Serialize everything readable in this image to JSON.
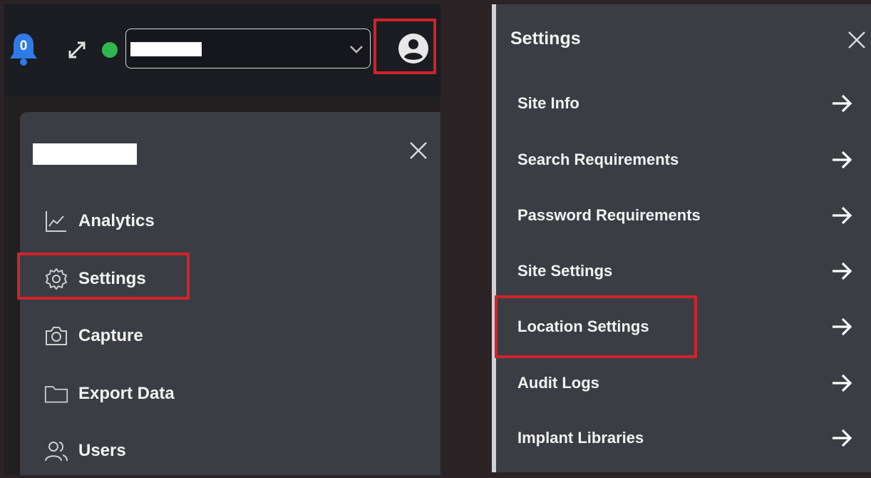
{
  "header": {
    "notification_count": "0",
    "site_selector": {
      "value": ""
    }
  },
  "user_menu": {
    "user_name": "",
    "items": [
      {
        "label": "Analytics",
        "icon": "analytics-icon"
      },
      {
        "label": "Settings",
        "icon": "gear-icon"
      },
      {
        "label": "Capture",
        "icon": "camera-icon"
      },
      {
        "label": "Export Data",
        "icon": "folder-icon"
      },
      {
        "label": "Users",
        "icon": "users-icon"
      }
    ]
  },
  "settings_panel": {
    "title": "Settings",
    "items": [
      {
        "label": "Site Info"
      },
      {
        "label": "Search Requirements"
      },
      {
        "label": "Password Requirements"
      },
      {
        "label": "Site Settings"
      },
      {
        "label": "Location Settings"
      },
      {
        "label": "Audit Logs"
      },
      {
        "label": "Implant Libraries"
      }
    ]
  },
  "colors": {
    "highlight": "#d0232a",
    "status_online": "#2fb84f",
    "bell": "#2f7be6",
    "panel_bg": "#3b3d44",
    "topbar_bg": "#1b1d22"
  }
}
